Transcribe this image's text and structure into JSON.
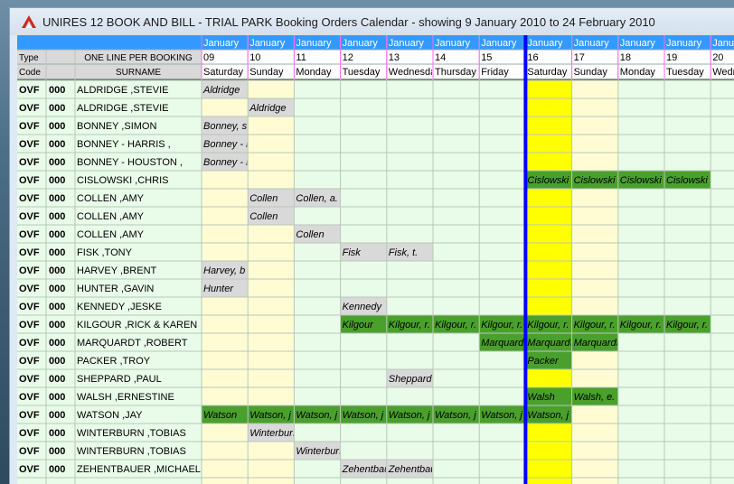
{
  "window": {
    "title": "UNIRES 12  BOOK AND BILL - TRIAL PARK Booking Orders Calendar - showing  9 January 2010  to  24 February 2010"
  },
  "header": {
    "type_label": "Type",
    "code_label": "Code",
    "booking_label": "ONE LINE PER BOOKING",
    "surname_label": "SURNAME",
    "days": [
      {
        "month": "January",
        "day": "09",
        "weekday": "Saturday"
      },
      {
        "month": "January",
        "day": "10",
        "weekday": "Sunday"
      },
      {
        "month": "January",
        "day": "11",
        "weekday": "Monday"
      },
      {
        "month": "January",
        "day": "12",
        "weekday": "Tuesday"
      },
      {
        "month": "January",
        "day": "13",
        "weekday": "Wednesday"
      },
      {
        "month": "January",
        "day": "14",
        "weekday": "Thursday"
      },
      {
        "month": "January",
        "day": "15",
        "weekday": "Friday"
      },
      {
        "month": "January",
        "day": "16",
        "weekday": "Saturday"
      },
      {
        "month": "January",
        "day": "17",
        "weekday": "Sunday"
      },
      {
        "month": "January",
        "day": "18",
        "weekday": "Monday"
      },
      {
        "month": "January",
        "day": "19",
        "weekday": "Tuesday"
      },
      {
        "month": "January",
        "day": "20",
        "weekday": "Wednesday"
      }
    ]
  },
  "today_day_index": 7,
  "rows": [
    {
      "type": "OVF",
      "code": "000",
      "surname": "ALDRIDGE ,STEVIE",
      "bookings": [
        {
          "start": 0,
          "end": 1,
          "label": "Aldridge",
          "status": "pending"
        }
      ]
    },
    {
      "type": "OVF",
      "code": "000",
      "surname": "ALDRIDGE ,STEVIE",
      "bookings": [
        {
          "start": 1,
          "end": 2,
          "label": "Aldridge",
          "status": "pending"
        }
      ]
    },
    {
      "type": "OVF",
      "code": "000",
      "surname": "BONNEY ,SIMON",
      "bookings": [
        {
          "start": 0,
          "end": 1,
          "label": "Bonney, s",
          "status": "pending"
        }
      ]
    },
    {
      "type": "OVF",
      "code": "000",
      "surname": "BONNEY - HARRIS ,",
      "bookings": [
        {
          "start": 0,
          "end": 1,
          "label": "Bonney - h",
          "status": "pending"
        }
      ]
    },
    {
      "type": "OVF",
      "code": "000",
      "surname": "BONNEY - HOUSTON ,",
      "bookings": [
        {
          "start": 0,
          "end": 1,
          "label": "Bonney - h",
          "status": "pending"
        }
      ]
    },
    {
      "type": "OVF",
      "code": "000",
      "surname": "CISLOWSKI ,CHRIS",
      "bookings": [
        {
          "start": 7,
          "end": 11,
          "label": "Cislowski",
          "status": "confirmed"
        }
      ]
    },
    {
      "type": "OVF",
      "code": "000",
      "surname": "COLLEN ,AMY",
      "bookings": [
        {
          "start": 1,
          "end": 2,
          "label": "Collen",
          "status": "pending"
        },
        {
          "start": 2,
          "end": 3,
          "label": "Collen, a.",
          "status": "pending"
        }
      ]
    },
    {
      "type": "OVF",
      "code": "000",
      "surname": "COLLEN ,AMY",
      "bookings": [
        {
          "start": 1,
          "end": 2,
          "label": "Collen",
          "status": "pending"
        }
      ]
    },
    {
      "type": "OVF",
      "code": "000",
      "surname": "COLLEN ,AMY",
      "bookings": [
        {
          "start": 2,
          "end": 3,
          "label": "Collen",
          "status": "pending"
        }
      ]
    },
    {
      "type": "OVF",
      "code": "000",
      "surname": "FISK ,TONY",
      "bookings": [
        {
          "start": 3,
          "end": 4,
          "label": "Fisk",
          "status": "pending"
        },
        {
          "start": 4,
          "end": 5,
          "label": "Fisk, t.",
          "status": "pending"
        }
      ]
    },
    {
      "type": "OVF",
      "code": "000",
      "surname": "HARVEY ,BRENT",
      "bookings": [
        {
          "start": 0,
          "end": 1,
          "label": "Harvey, b",
          "status": "pending"
        }
      ]
    },
    {
      "type": "OVF",
      "code": "000",
      "surname": "HUNTER ,GAVIN",
      "bookings": [
        {
          "start": 0,
          "end": 1,
          "label": "Hunter",
          "status": "pending"
        }
      ]
    },
    {
      "type": "OVF",
      "code": "000",
      "surname": "KENNEDY ,JESKE",
      "bookings": [
        {
          "start": 3,
          "end": 4,
          "label": "Kennedy",
          "status": "pending"
        }
      ]
    },
    {
      "type": "OVF",
      "code": "000",
      "surname": "KILGOUR ,RICK & KAREN",
      "bookings": [
        {
          "start": 3,
          "end": 4,
          "label": "Kilgour",
          "status": "confirmed"
        },
        {
          "start": 4,
          "end": 11,
          "label": "Kilgour, r.",
          "status": "confirmed"
        }
      ]
    },
    {
      "type": "OVF",
      "code": "000",
      "surname": "MARQUARDT ,ROBERT",
      "bookings": [
        {
          "start": 6,
          "end": 9,
          "label": "Marquardt",
          "status": "confirmed"
        }
      ]
    },
    {
      "type": "OVF",
      "code": "000",
      "surname": "PACKER ,TROY",
      "bookings": [
        {
          "start": 7,
          "end": 8,
          "label": "Packer",
          "status": "confirmed"
        }
      ]
    },
    {
      "type": "OVF",
      "code": "000",
      "surname": "SHEPPARD ,PAUL",
      "bookings": [
        {
          "start": 4,
          "end": 5,
          "label": "Sheppard",
          "status": "pending"
        }
      ]
    },
    {
      "type": "OVF",
      "code": "000",
      "surname": "WALSH ,ERNESTINE",
      "bookings": [
        {
          "start": 7,
          "end": 8,
          "label": "Walsh",
          "status": "confirmed"
        },
        {
          "start": 8,
          "end": 9,
          "label": "Walsh, e.",
          "status": "confirmed"
        }
      ]
    },
    {
      "type": "OVF",
      "code": "000",
      "surname": "WATSON ,JAY",
      "bookings": [
        {
          "start": 0,
          "end": 1,
          "label": "Watson",
          "status": "confirmed"
        },
        {
          "start": 1,
          "end": 8,
          "label": "Watson, j",
          "status": "confirmed"
        }
      ]
    },
    {
      "type": "OVF",
      "code": "000",
      "surname": "WINTERBURN ,TOBIAS",
      "bookings": [
        {
          "start": 1,
          "end": 2,
          "label": "Winterburn",
          "status": "pending"
        }
      ]
    },
    {
      "type": "OVF",
      "code": "000",
      "surname": "WINTERBURN ,TOBIAS",
      "bookings": [
        {
          "start": 2,
          "end": 3,
          "label": "Winterburn",
          "status": "pending"
        }
      ]
    },
    {
      "type": "OVF",
      "code": "000",
      "surname": "ZEHENTBAUER ,MICHAEL",
      "bookings": [
        {
          "start": 3,
          "end": 4,
          "label": "Zehentbau",
          "status": "pending"
        },
        {
          "start": 4,
          "end": 5,
          "label": "Zehentbau",
          "status": "pending"
        }
      ]
    }
  ],
  "colors": {
    "header_blue": "#3399ff",
    "header_gray": "#d9d9d9",
    "header_text_white": "#ffffff",
    "row_bg": "#e9fbe9",
    "weekend_bg": "#fffcd4",
    "today_bg": "#ffff00",
    "today_line": "#0000ff",
    "pending_bg": "#d9d9d9",
    "confirmed_bg": "#4aa02c",
    "grid_line": "#b8c8b8",
    "month_divider": "#ff66ff"
  }
}
